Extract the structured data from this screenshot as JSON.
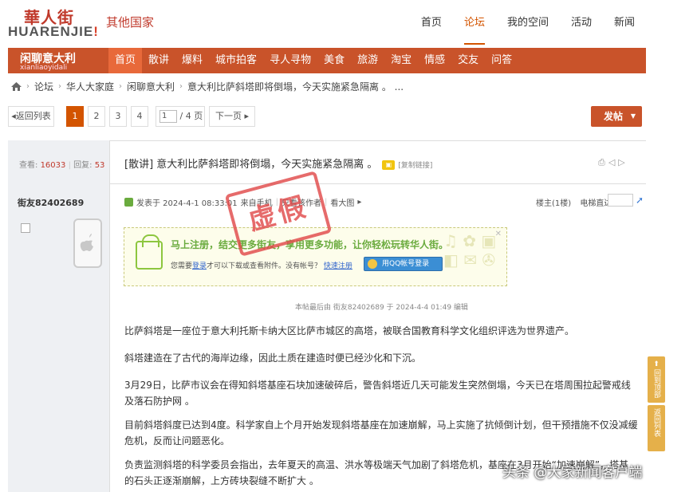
{
  "logo": {
    "cn": "華人街",
    "en_main": "HUARENJIE",
    "en_dot": "!"
  },
  "site_name": "其他国家",
  "top_nav": [
    "首页",
    "论坛",
    "我的空间",
    "活动",
    "新闻"
  ],
  "forum": {
    "name": "闲聊意大利",
    "sub": "xianliaoyidali"
  },
  "nav_items": [
    "首页",
    "散讲",
    "爆料",
    "城市拍客",
    "寻人寻物",
    "美食",
    "旅游",
    "淘宝",
    "情感",
    "交友",
    "问答"
  ],
  "breadcrumb": [
    "论坛",
    "华人大家庭",
    "闲聊意大利",
    "意大利比萨斜塔即将倒塌，今天实施紧急隔离 。 ..."
  ],
  "pager": {
    "back": "返回列表",
    "pages": [
      "1",
      "2",
      "3",
      "4"
    ],
    "current_input": "1",
    "total": "/ 4 页",
    "next": "下一页",
    "post": "发帖"
  },
  "stats": {
    "views_label": "查看:",
    "views": "16033",
    "replies_label": "回复:",
    "replies": "53"
  },
  "thread": {
    "title": "[散讲] 意大利比萨斜塔即将倒塌，今天实施紧急隔离 。",
    "copy_link": "[复制链接]"
  },
  "author": "街友82402689",
  "meta": {
    "posted": "发表于 2024-4-1 08:33:01",
    "from": "来自手机",
    "only": "只看该作者",
    "view_large": "看大图",
    "floor": "楼主(1楼)",
    "jump": "电梯直达"
  },
  "stamp": "虚假",
  "register": {
    "main": "马上注册，结交更多街友，享用更多功能，让你轻松玩转华人街。",
    "sub_pre": "您需要",
    "login": "登录",
    "sub_mid": "才可以下载或查看附件。没有帐号？",
    "quick": "快速注册",
    "qq_btn": "用QQ帐号登录"
  },
  "edit_note": "本帖最后由 街友82402689 于 2024-4-4 01:49 编辑",
  "paragraphs": [
    "比萨斜塔是一座位于意大利托斯卡纳大区比萨市城区的高塔，被联合国教育科学文化组织评选为世界遗产。",
    "斜塔建造在了古代的海岸边缘，因此土质在建造时便已经沙化和下沉。",
    "3月29日，比萨市议会在得知斜塔基座石块加速破碎后，警告斜塔近几天可能发生突然倒塌，今天已在塔周围拉起警戒线及落石防护网 。",
    "目前斜塔斜度已达到4度。科学家自上个月开始发现斜塔基座在加速崩解，马上实施了抗倾倒计划，但干预措施不仅没减缓危机，反而让问题恶化。",
    "负责监测斜塔的科学委员会指出，去年夏天的高温、洪水等极端天气加剧了斜塔危机，基座在3月开始“加速崩解”，塔基的石头正逐渐崩解，上方砖块裂缝不断扩大 。"
  ],
  "side_tabs": [
    "回到顶部",
    "返回列表"
  ],
  "watermark": "头条 @大家新闻客户端"
}
